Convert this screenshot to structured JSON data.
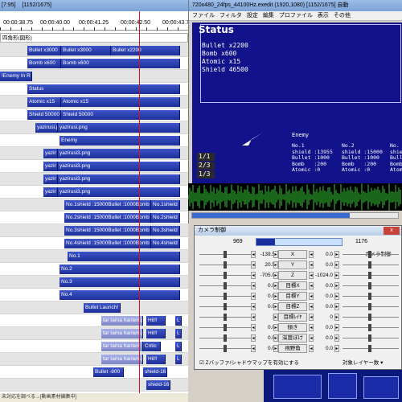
{
  "timeline": {
    "title_partial": "[7:95]",
    "title_frame": "[1152/1675]",
    "ruler": [
      "00:00:38.75",
      "00:00:40.00",
      "00:00:41.25",
      "00:00:42.50",
      "00:00:43.75"
    ],
    "status": "未対応を調べる→[動画素材編集中]",
    "tracks": [
      {
        "clips": [
          {
            "label": "四角形(図形)",
            "l": 0,
            "w": 234,
            "style": "white"
          }
        ]
      },
      {
        "clips": [
          {
            "label": "Bullet x3000",
            "l": 34,
            "w": 42
          },
          {
            "label": "Bullet x3000",
            "l": 76,
            "w": 62
          },
          {
            "label": "Bullet x2200",
            "l": 138,
            "w": 86
          }
        ]
      },
      {
        "clips": [
          {
            "label": "Bomb x600",
            "l": 34,
            "w": 42
          },
          {
            "label": "Bomb x600",
            "l": 76,
            "w": 148
          }
        ]
      },
      {
        "clips": [
          {
            "label": "!Enemy In R",
            "l": 0,
            "w": 40
          }
        ]
      },
      {
        "clips": [
          {
            "label": "Status",
            "l": 34,
            "w": 190
          }
        ]
      },
      {
        "clips": [
          {
            "label": "Atomic x15",
            "l": 34,
            "w": 42
          },
          {
            "label": "Atomic x15",
            "l": 76,
            "w": 148
          }
        ]
      },
      {
        "clips": [
          {
            "label": "Shield 50000",
            "l": 34,
            "w": 42
          },
          {
            "label": "Shield 50000",
            "l": 76,
            "w": 148
          }
        ]
      },
      {
        "clips": [
          {
            "label": "yazirusi.p",
            "l": 44,
            "w": 28
          },
          {
            "label": "yazirusi.png",
            "l": 72,
            "w": 152
          }
        ]
      },
      {
        "clips": [
          {
            "label": "Enemy",
            "l": 74,
            "w": 150
          }
        ]
      },
      {
        "clips": [
          {
            "label": "yazir",
            "l": 54,
            "w": 18
          },
          {
            "label": "yazirusi3.png",
            "l": 72,
            "w": 152
          }
        ]
      },
      {
        "clips": [
          {
            "label": "yazir",
            "l": 54,
            "w": 18
          },
          {
            "label": "yazirusi3.png",
            "l": 72,
            "w": 152
          }
        ]
      },
      {
        "clips": [
          {
            "label": "yazir",
            "l": 54,
            "w": 18
          },
          {
            "label": "yazirusi3.png",
            "l": 72,
            "w": 152
          }
        ]
      },
      {
        "clips": [
          {
            "label": "yazir",
            "l": 54,
            "w": 18
          },
          {
            "label": "yazirusi3.png",
            "l": 72,
            "w": 152
          }
        ]
      },
      {
        "clips": [
          {
            "label": "No.1shield :15000Bullet :1000Bomb",
            "l": 80,
            "w": 108
          },
          {
            "label": "No.1shield",
            "l": 188,
            "w": 36
          }
        ]
      },
      {
        "clips": [
          {
            "label": "No.2shield :15000Bullet :1000Bomb",
            "l": 80,
            "w": 108
          },
          {
            "label": "No.2shield :",
            "l": 188,
            "w": 36
          }
        ]
      },
      {
        "clips": [
          {
            "label": "No.3shield :15000Bullet :1000Bomb",
            "l": 80,
            "w": 108
          },
          {
            "label": "No.3shield",
            "l": 188,
            "w": 36
          }
        ]
      },
      {
        "clips": [
          {
            "label": "No.4shield :15000Bullet :1000Bomb",
            "l": 80,
            "w": 108
          },
          {
            "label": "No.4shield",
            "l": 188,
            "w": 36
          }
        ]
      },
      {
        "clips": [
          {
            "label": "No.1",
            "l": 84,
            "w": 140
          }
        ]
      },
      {
        "clips": [
          {
            "label": "No.2",
            "l": 74,
            "w": 150
          }
        ]
      },
      {
        "clips": [
          {
            "label": "No.3",
            "l": 74,
            "w": 150
          }
        ]
      },
      {
        "clips": [
          {
            "label": "No.4",
            "l": 74,
            "w": 150
          }
        ]
      },
      {
        "clips": [
          {
            "label": "Bullet Launch!",
            "l": 104,
            "w": 46
          }
        ]
      },
      {
        "clips": [
          {
            "label": "tar tama hanten.pn",
            "l": 126,
            "w": 52,
            "style": "light"
          },
          {
            "label": "Hit!!",
            "l": 182,
            "w": 24
          },
          {
            "label": "L",
            "l": 218,
            "w": 8
          }
        ]
      },
      {
        "clips": [
          {
            "label": "tar tama hanten.pn",
            "l": 126,
            "w": 52,
            "style": "light"
          },
          {
            "label": "Hit!!",
            "l": 182,
            "w": 24
          },
          {
            "label": "L",
            "l": 218,
            "w": 8
          }
        ]
      },
      {
        "clips": [
          {
            "label": "tar tama hanten",
            "l": 126,
            "w": 52,
            "style": "light"
          },
          {
            "label": "Critic",
            "l": 178,
            "w": 22
          },
          {
            "label": "L",
            "l": 218,
            "w": 8
          }
        ]
      },
      {
        "clips": [
          {
            "label": "tar tama hanten.pn",
            "l": 126,
            "w": 52,
            "style": "light"
          },
          {
            "label": "Hit!!",
            "l": 182,
            "w": 24
          },
          {
            "label": "L",
            "l": 218,
            "w": 8
          }
        ]
      },
      {
        "clips": [
          {
            "label": "Bullet -800",
            "l": 116,
            "w": 38
          },
          {
            "label": "shield-16",
            "l": 178,
            "w": 30
          }
        ]
      },
      {
        "clips": [
          {
            "label": "shield-16",
            "l": 182,
            "w": 30
          }
        ]
      }
    ]
  },
  "preview": {
    "title": "720x480_24fps_44100Hz.exedit (1920,1080)  [1152/1675]  自動",
    "menu": [
      "ファイル",
      "フィルタ",
      "設定",
      "編集",
      "プロファイル",
      "表示",
      "その他"
    ],
    "status_title": "Status",
    "stats": [
      "Bullet x2200",
      "Bomb x600",
      "Atomic x15",
      "Shield 46500"
    ],
    "enemy_label": "Enemy",
    "enemy_cols": [
      "No.1\nshield :13955\nBullet :1000\nBomb   :200\nAtomic :0",
      "No.2\nshield :15000\nBullet :1000\nBomb   :200\nAtomic :0",
      "No.\nshie\nBull\nBomb\nAtom"
    ],
    "page_indicators": [
      "1/1",
      "2/3",
      "1/3"
    ]
  },
  "camera": {
    "title": "カメラ制御",
    "close": "x",
    "frame_start": "969",
    "frame_end": "1176",
    "frame_progress": 0.22,
    "top_right": "カメラ制御",
    "params": [
      {
        "left": "-139.5",
        "name": "X",
        "right": "0.0"
      },
      {
        "left": "20.5",
        "name": "Y",
        "right": "0.0"
      },
      {
        "left": "-705.0",
        "name": "Z",
        "right": "-1024.0"
      },
      {
        "left": "0.0",
        "name": "目標X",
        "right": "0.0"
      },
      {
        "left": "0.0",
        "name": "目標Y",
        "right": "0.0"
      },
      {
        "left": "0.0",
        "name": "目標Z",
        "right": "0.0"
      },
      {
        "left": "1",
        "name": "目標ﾚｲﾔ",
        "right": "0"
      },
      {
        "left": "0.0",
        "name": "傾き",
        "right": "0.0"
      },
      {
        "left": "0.0",
        "name": "深度ぼけ",
        "right": "0.0"
      },
      {
        "left": "0.0",
        "name": "視野角",
        "right": "0.0"
      }
    ],
    "checkbox": "Zバッファ/シャドウマップを有効にする",
    "layer": "対象レイヤー数"
  },
  "colors": {
    "clip": "#1e2e9a",
    "canvas": "#12128a",
    "cursor": "#e01010",
    "wave": "#33cc33"
  }
}
